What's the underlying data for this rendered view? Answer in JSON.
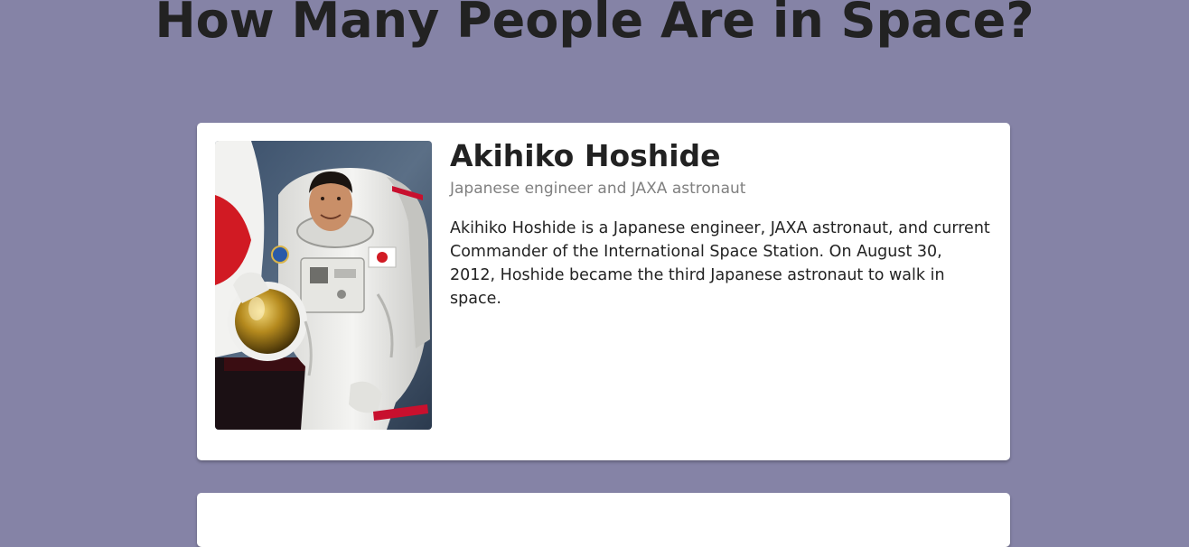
{
  "page": {
    "title": "How Many People Are in Space?"
  },
  "people": [
    {
      "name": "Akihiko Hoshide",
      "role": "Japanese engineer and JAXA astronaut",
      "bio": "Akihiko Hoshide is a Japanese engineer, JAXA astronaut, and current Commander of the International Space Station. On August 30, 2012, Hoshide became the third Japanese astronaut to walk in space."
    }
  ],
  "colors": {
    "page_background": "#8583a6",
    "card_background": "#ffffff",
    "title_text": "#222222",
    "subtitle_text": "#808080"
  }
}
